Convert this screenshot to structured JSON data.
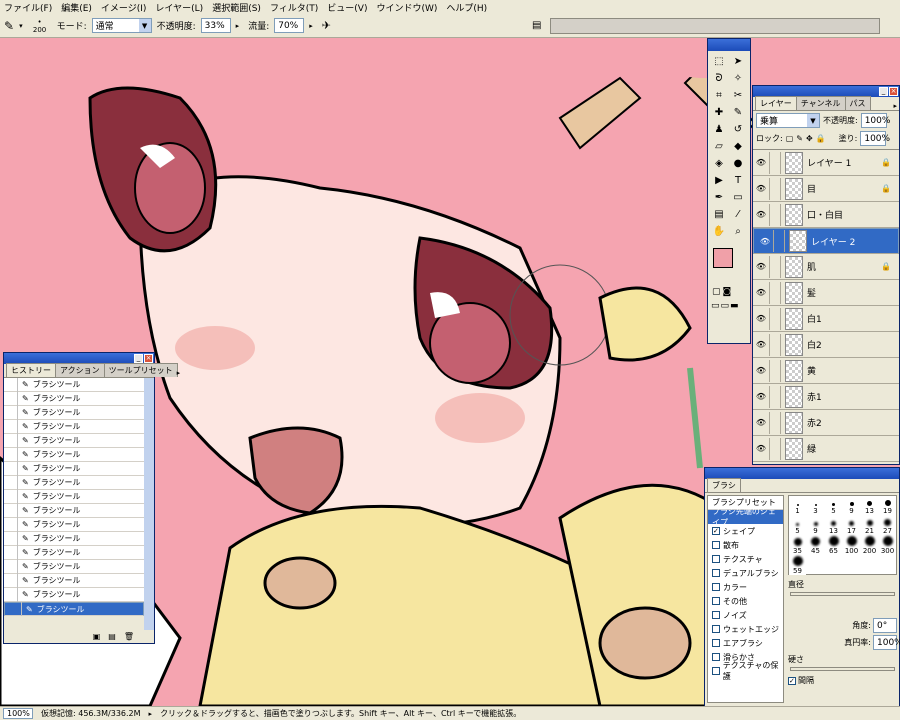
{
  "menu": [
    "ファイル(F)",
    "編集(E)",
    "イメージ(I)",
    "レイヤー(L)",
    "選択範囲(S)",
    "フィルタ(T)",
    "ビュー(V)",
    "ウインドウ(W)",
    "ヘルプ(H)"
  ],
  "options": {
    "brush_size": "200",
    "mode_label": "モード:",
    "mode_value": "通常",
    "opacity_label": "不透明度:",
    "opacity_value": "33%",
    "flow_label": "流量:",
    "flow_value": "70%"
  },
  "status": {
    "zoom": "100%",
    "memory": "仮想記憶: 456.3M/336.2M",
    "hint": "クリック＆ドラッグすると、描画色で塗りつぶします。Shift キー、Alt キー、Ctrl キーで機能拡張。"
  },
  "history": {
    "tabs": [
      "ヒストリー",
      "アクション",
      "ツールプリセット"
    ],
    "items": [
      "ブラシツール",
      "ブラシツール",
      "ブラシツール",
      "ブラシツール",
      "ブラシツール",
      "ブラシツール",
      "ブラシツール",
      "ブラシツール",
      "ブラシツール",
      "ブラシツール",
      "ブラシツール",
      "ブラシツール",
      "ブラシツール",
      "ブラシツール",
      "ブラシツール",
      "ブラシツール",
      "ブラシツール"
    ]
  },
  "layers": {
    "tabs": [
      "レイヤー",
      "チャンネル",
      "パス"
    ],
    "blend_mode": "乗算",
    "opacity_label": "不透明度:",
    "opacity_value": "100%",
    "lock_label": "ロック:",
    "fill_label": "塗り:",
    "fill_value": "100%",
    "items": [
      {
        "name": "レイヤー 1",
        "locked": true
      },
      {
        "name": "目",
        "locked": true
      },
      {
        "name": "口・白目",
        "locked": false
      },
      {
        "name": "レイヤー 2",
        "locked": false,
        "selected": true
      },
      {
        "name": "肌",
        "locked": true
      },
      {
        "name": "髪",
        "locked": false
      },
      {
        "name": "白1",
        "locked": false
      },
      {
        "name": "白2",
        "locked": false
      },
      {
        "name": "黄",
        "locked": false
      },
      {
        "name": "赤1",
        "locked": false
      },
      {
        "name": "赤2",
        "locked": false
      },
      {
        "name": "緑",
        "locked": false
      }
    ]
  },
  "brushes": {
    "tab": "ブラシ",
    "sections": [
      "ブラシプリセット",
      "ブラシ先端のシェイプ"
    ],
    "options": [
      {
        "label": "シェイプ",
        "checked": true
      },
      {
        "label": "散布",
        "checked": false
      },
      {
        "label": "テクスチャ",
        "checked": false
      },
      {
        "label": "デュアルブラシ",
        "checked": false
      },
      {
        "label": "カラー",
        "checked": false
      },
      {
        "label": "その他",
        "checked": false
      },
      {
        "label": "ノイズ",
        "checked": false
      },
      {
        "label": "ウェットエッジ",
        "checked": false
      },
      {
        "label": "エアブラシ",
        "checked": false
      },
      {
        "label": "滑らかさ",
        "checked": false
      },
      {
        "label": "テクスチャの保護",
        "checked": false
      }
    ],
    "sizes": [
      "1",
      "3",
      "5",
      "9",
      "13",
      "19",
      "5",
      "9",
      "13",
      "17",
      "21",
      "27",
      "35",
      "45",
      "65",
      "100",
      "200",
      "300",
      "59"
    ],
    "diameter_label": "直径",
    "angle_label": "角度:",
    "angle_value": "0°",
    "roundness_label": "真円率:",
    "roundness_value": "100%",
    "hardness_label": "硬さ",
    "spacing_label": "間隔"
  },
  "colors": {
    "foreground": "#f0a0a8",
    "background": "#ffffff",
    "accent": "#316ac5"
  }
}
